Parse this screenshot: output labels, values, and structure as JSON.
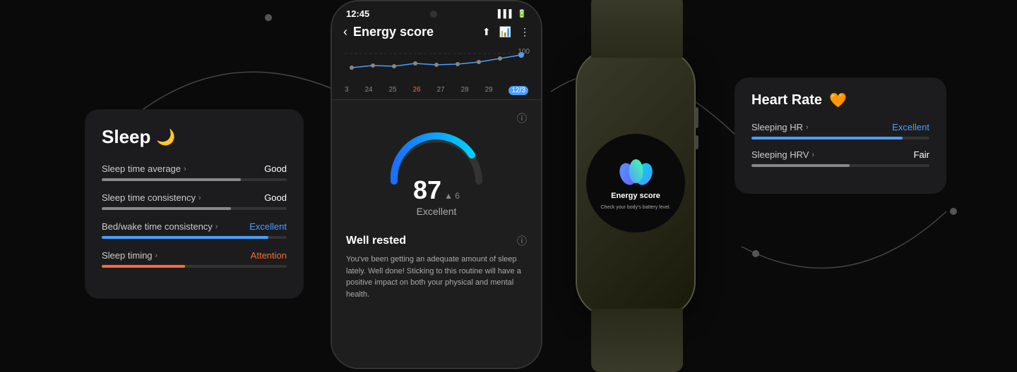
{
  "app": {
    "time": "12:45",
    "battery": "100%",
    "signal": "▌▌▌"
  },
  "phone": {
    "header": {
      "back_label": "‹",
      "title": "Energy score",
      "share_icon": "share",
      "chart_icon": "chart",
      "more_icon": "⋮"
    },
    "chart": {
      "value_label": "100",
      "dates": [
        "3",
        "24",
        "25",
        "26",
        "27",
        "28",
        "29",
        "12/3"
      ],
      "active_date": "12/3"
    },
    "score": {
      "number": "87",
      "delta": "▲ 6",
      "label": "Excellent"
    },
    "well_rested": {
      "title": "Well rested",
      "description": "You've been getting an adequate amount of sleep lately. Well done! Sticking to this routine will have a positive impact on both your physical and mental health."
    }
  },
  "sleep_card": {
    "title": "Sleep",
    "moon_icon": "🌙",
    "metrics": [
      {
        "label": "Sleep time average",
        "value": "Good",
        "value_type": "good",
        "fill": "fill-good"
      },
      {
        "label": "Sleep time consistency",
        "value": "Good",
        "value_type": "good",
        "fill": "fill-good2"
      },
      {
        "label": "Bed/wake time consistency",
        "value": "Excellent",
        "value_type": "excellent",
        "fill": "fill-excellent"
      },
      {
        "label": "Sleep timing",
        "value": "Attention",
        "value_type": "attention",
        "fill": "fill-attention"
      }
    ]
  },
  "heart_rate_card": {
    "title": "Heart Rate",
    "heart_icon": "🧡",
    "metrics": [
      {
        "label": "Sleeping HR",
        "value": "Excellent",
        "value_type": "excellent",
        "fill": "hr-fill-excellent"
      },
      {
        "label": "Sleeping HRV",
        "value": "Fair",
        "value_type": "fair",
        "fill": "hr-fill-fair"
      }
    ]
  },
  "watch": {
    "energy_title": "Energy score",
    "energy_desc": "Check your body's battery level."
  }
}
